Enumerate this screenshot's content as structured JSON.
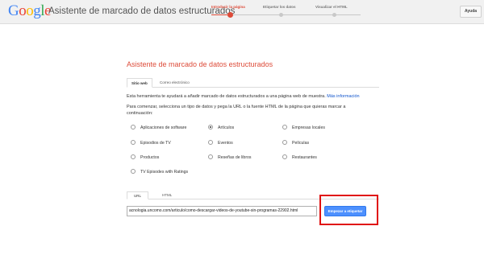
{
  "header": {
    "logo": [
      "G",
      "o",
      "o",
      "g",
      "l",
      "e"
    ],
    "logo_colors": [
      "#4285f4",
      "#ea4335",
      "#fbbc05",
      "#4285f4",
      "#34a853",
      "#ea4335"
    ],
    "app_title": "Asistente de marcado de datos estructurados",
    "steps": [
      "Introducir la página",
      "Etiquetar los datos",
      "Visualizar el HTML"
    ],
    "active_step": 0,
    "help_label": "Ayuda"
  },
  "main": {
    "title": "Asistente de marcado de datos estructurados",
    "tabs": [
      "Sitio web",
      "Correo electrónico"
    ],
    "intro": "Esta herramienta te ayudará a añadir marcado de datos estructurados a una página web de muestra.",
    "intro_link": "Más información",
    "instruction_line1": "Para comenzar, selecciona un tipo de datos y pega la URL o la fuente HTML de la página que quieras marcar a",
    "instruction_line2": "continuación:",
    "data_types": [
      "Aplicaciones de software",
      "Artículos",
      "Empresas locales",
      "Episodios de TV",
      "Eventos",
      "Películas",
      "Productos",
      "Reseñas de libros",
      "Restaurantes",
      "TV Episodes with Ratings"
    ],
    "selected_type": "Artículos",
    "input_tabs": [
      "URL",
      "HTML"
    ],
    "url_value": "acnologia.uncomo.com/articulo/como-descargar-videos-de-youtube-sin-programas-22902.html",
    "start_button": "Empezar a etiquetar",
    "accent_color": "#dd4b39",
    "button_color": "#4d90fe",
    "highlight_color": "#e01010"
  }
}
